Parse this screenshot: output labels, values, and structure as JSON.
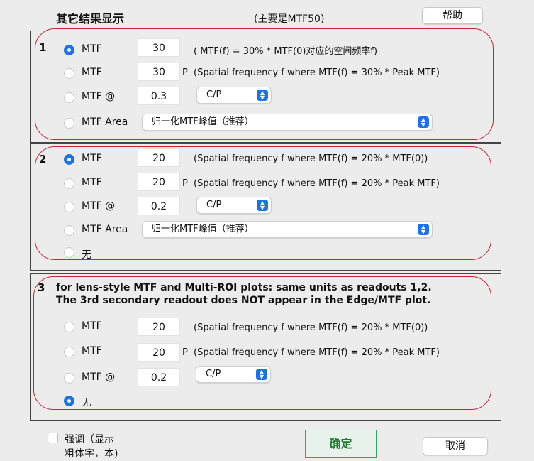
{
  "header": {
    "title": "其它结果显示",
    "subtitle": "(主要是MTF50)",
    "help_label": "帮助"
  },
  "sections": [
    {
      "number": "1",
      "rows": [
        {
          "label": "MTF",
          "value": "30",
          "prefix": "",
          "description": "( MTF(f) = 30% * MTF(0)对应的空间频率f)",
          "selected": true
        },
        {
          "label": "MTF",
          "value": "30",
          "prefix": "P",
          "description": "(Spatial frequency f where MTF(f) = 30% * Peak MTF)",
          "selected": false
        },
        {
          "label": "MTF @",
          "value": "0.3",
          "select": "C/P",
          "selected": false
        },
        {
          "label": "MTF Area",
          "select": "归一化MTF峰值（推荐）",
          "selected": false
        }
      ]
    },
    {
      "number": "2",
      "rows": [
        {
          "label": "MTF",
          "value": "20",
          "prefix": "",
          "description": "(Spatial frequency f where MTF(f) = 20% * MTF(0))",
          "selected": true
        },
        {
          "label": "MTF",
          "value": "20",
          "prefix": "P",
          "description": "(Spatial frequency f where MTF(f) = 20% * Peak MTF)",
          "selected": false
        },
        {
          "label": "MTF @",
          "value": "0.2",
          "select": "C/P",
          "selected": false
        },
        {
          "label": "MTF Area",
          "select": "归一化MTF峰值（推荐）",
          "selected": false
        },
        {
          "label": "无",
          "selected": false
        }
      ]
    },
    {
      "number": "3",
      "note_line1": "for lens-style MTF and Multi-ROI plots:  same units as readouts 1,2.",
      "note_line2": "The 3rd secondary readout does NOT appear in the Edge/MTF plot.",
      "rows": [
        {
          "label": "MTF",
          "value": "20",
          "prefix": "",
          "description": "(Spatial frequency f where MTF(f) = 20% * MTF(0))",
          "selected": false
        },
        {
          "label": "MTF",
          "value": "20",
          "prefix": "P",
          "description": "(Spatial frequency f where MTF(f) = 20% * Peak MTF)",
          "selected": false
        },
        {
          "label": "MTF @",
          "value": "0.2",
          "select": "C/P",
          "selected": false
        },
        {
          "label": "无",
          "selected": true
        }
      ]
    }
  ],
  "footer": {
    "checkbox_line1": "强调（显示",
    "checkbox_line2": "粗体字，本)",
    "ok_label": "确定",
    "cancel_label": "取消"
  },
  "colors": {
    "accent": "#1a73e8",
    "highlight_oval": "#d21f2f",
    "ok_border": "#39a45b"
  }
}
